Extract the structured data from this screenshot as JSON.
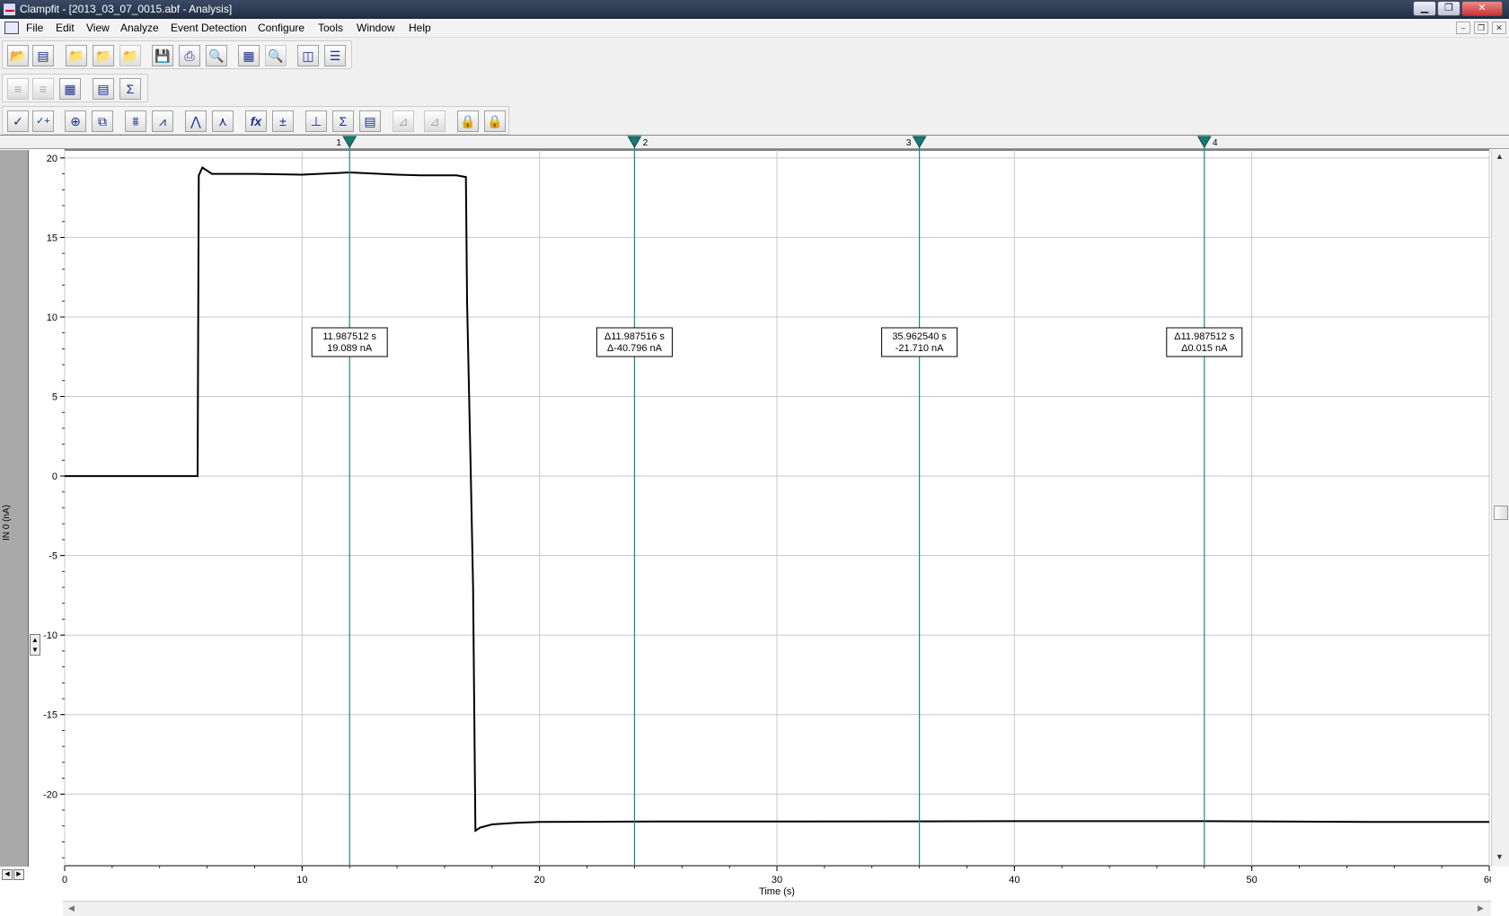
{
  "window": {
    "title": "Clampfit - [2013_03_07_0015.abf - Analysis]",
    "minimize": "▁",
    "maximize": "❐",
    "close": "✕"
  },
  "menu": {
    "items": [
      "File",
      "Edit",
      "View",
      "Analyze",
      "Event Detection",
      "Configure",
      "Tools",
      "Window",
      "Help"
    ],
    "mdi_min": "–",
    "mdi_restore": "❐",
    "mdi_close": "✕"
  },
  "toolbar1": [
    {
      "icon": "open-data-icon",
      "glyph": "📂"
    },
    {
      "icon": "open-protocol-icon",
      "glyph": "▤"
    },
    {
      "icon": "open-folder-icon",
      "glyph": "📁"
    },
    {
      "icon": "open-folder-alt-icon",
      "glyph": "📁"
    },
    {
      "icon": "folder-disabled-icon",
      "glyph": "📁",
      "disabled": true
    },
    {
      "icon": "save-icon",
      "glyph": "💾"
    },
    {
      "icon": "print-icon",
      "glyph": "⎙"
    },
    {
      "icon": "print-preview-icon",
      "glyph": "🔍"
    },
    {
      "icon": "copy-page-icon",
      "glyph": "▦"
    },
    {
      "icon": "find-disabled-icon",
      "glyph": "🔍",
      "disabled": true
    },
    {
      "icon": "split-vertical-icon",
      "glyph": "◫"
    },
    {
      "icon": "split-horizontal-icon",
      "glyph": "☰"
    }
  ],
  "toolbar2": [
    {
      "icon": "trace-list-disabled-icon",
      "glyph": "≡",
      "disabled": true
    },
    {
      "icon": "trace-list-alt-disabled-icon",
      "glyph": "≡",
      "disabled": true
    },
    {
      "icon": "results-window-icon",
      "glyph": "▦"
    },
    {
      "icon": "layout-window-icon",
      "glyph": "▤"
    },
    {
      "icon": "statistics-window-icon",
      "glyph": "Σ"
    }
  ],
  "toolbar3": [
    {
      "icon": "accept-check-icon",
      "glyph": "✓"
    },
    {
      "icon": "accept-plus-icon",
      "glyph": "✓+"
    },
    {
      "icon": "zoom-icon",
      "glyph": "⊕"
    },
    {
      "icon": "full-scale-icon",
      "glyph": "⧉"
    },
    {
      "icon": "baseline-icon",
      "glyph": "⩩"
    },
    {
      "icon": "event-template-icon",
      "glyph": "⩘"
    },
    {
      "icon": "histogram-icon",
      "glyph": "⋀"
    },
    {
      "icon": "peak-histogram-icon",
      "glyph": "⋏"
    },
    {
      "icon": "function-fx-icon",
      "glyph": "fx"
    },
    {
      "icon": "arithmetic-icon",
      "glyph": "±"
    },
    {
      "icon": "cursor-measure-icon",
      "glyph": "⊥"
    },
    {
      "icon": "integrate-sigma-icon",
      "glyph": "Σ"
    },
    {
      "icon": "statistics-table-icon",
      "glyph": "▤"
    },
    {
      "icon": "chart-disabled-icon",
      "glyph": "⊿",
      "disabled": true
    },
    {
      "icon": "chart-alt-disabled-icon",
      "glyph": "⊿",
      "disabled": true
    },
    {
      "icon": "lock-cursors-12-icon",
      "glyph": "🔒"
    },
    {
      "icon": "lock-cursors-34-icon",
      "glyph": "🔒"
    }
  ],
  "plot": {
    "y_label": "IN 0 (nA)",
    "x_label": "Time (s)",
    "y_ticks": [
      "20",
      "15",
      "10",
      "5",
      "0",
      "-5",
      "-10",
      "-15",
      "-20"
    ],
    "x_ticks": [
      "0",
      "10",
      "20",
      "30",
      "40",
      "50",
      "60"
    ],
    "cursors": [
      {
        "num": "1",
        "time": 12.0,
        "line1": "11.987512 s",
        "line2": "19.089 nA"
      },
      {
        "num": "2",
        "time": 24.0,
        "line1": "Δ11.987516 s",
        "line2": "Δ-40.796 nA"
      },
      {
        "num": "3",
        "time": 36.0,
        "line1": "35.962540 s",
        "line2": "-21.710 nA"
      },
      {
        "num": "4",
        "time": 48.0,
        "line1": "Δ11.987512 s",
        "line2": "Δ0.015 nA"
      }
    ],
    "colors": {
      "cursor": "#1b8a80",
      "trace": "#000000",
      "grid": "#c8c8c8"
    }
  },
  "chart_data": {
    "type": "line",
    "xlabel": "Time (s)",
    "ylabel": "IN 0 (nA)",
    "xlim": [
      0,
      60
    ],
    "ylim": [
      -24.5,
      20.5
    ],
    "grid": true,
    "series": [
      {
        "x": [
          0,
          5.6,
          5.65,
          5.8,
          6.2,
          8,
          10,
          12,
          14,
          15,
          16.5,
          16.9,
          16.95,
          17.1,
          17.2,
          17.3,
          17.5,
          18,
          19,
          20,
          25,
          30,
          36,
          40,
          48,
          55,
          60
        ],
        "y": [
          0,
          0,
          18.9,
          19.4,
          19.0,
          19.0,
          18.95,
          19.09,
          18.95,
          18.9,
          18.9,
          18.8,
          11.0,
          0.5,
          -7.0,
          -22.3,
          -22.1,
          -21.9,
          -21.8,
          -21.75,
          -21.72,
          -21.72,
          -21.71,
          -21.7,
          -21.7,
          -21.75,
          -21.75
        ]
      }
    ],
    "cursors": [
      12.0,
      24.0,
      36.0,
      48.0
    ]
  }
}
